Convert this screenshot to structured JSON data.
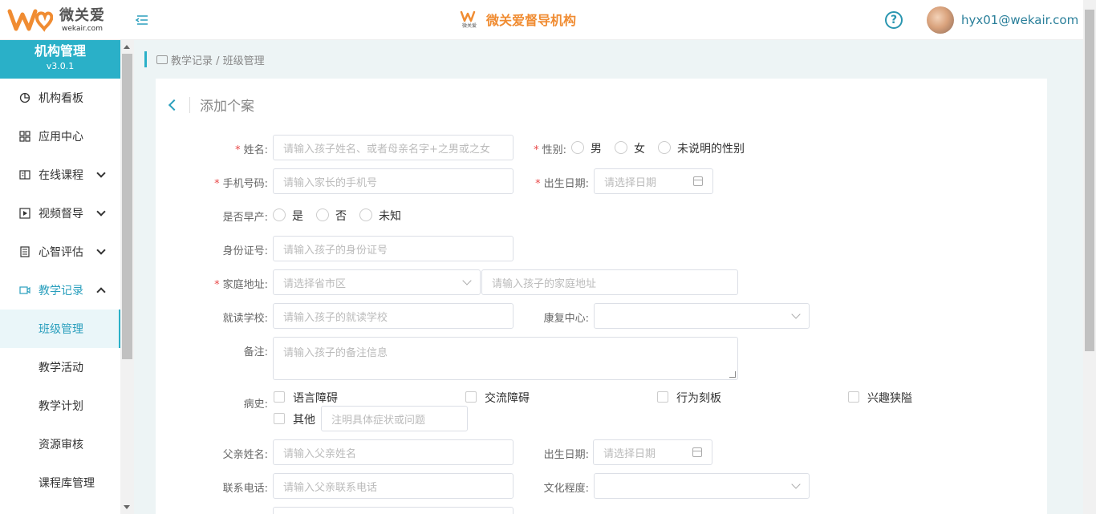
{
  "header": {
    "logo_cn": "微关爱",
    "logo_en": "wekair.com",
    "mini_logo_text": "微关爱",
    "brand_title": "微关爱督导机构",
    "help_label": "?",
    "user_email": "hyx01@wekair.com"
  },
  "sidebar": {
    "title": "机构管理",
    "version": "v3.0.1",
    "items": [
      {
        "label": "机构看板",
        "icon": "pie-chart-icon"
      },
      {
        "label": "应用中心",
        "icon": "grid-icon"
      },
      {
        "label": "在线课程",
        "icon": "book-icon"
      },
      {
        "label": "视频督导",
        "icon": "play-icon"
      },
      {
        "label": "心智评估",
        "icon": "clipboard-icon"
      },
      {
        "label": "教学记录",
        "icon": "video-icon"
      }
    ],
    "sub_items": [
      "班级管理",
      "教学活动",
      "教学计划",
      "资源审核",
      "课程库管理"
    ]
  },
  "breadcrumb": "教学记录 / 班级管理",
  "page_title": "添加个案",
  "form": {
    "name_label": "姓名:",
    "name_placeholder": "请输入孩子姓名、或者母亲名字+之男或之女",
    "gender_label": "性别:",
    "gender_options": [
      "男",
      "女",
      "未说明的性别"
    ],
    "phone_label": "手机号码:",
    "phone_placeholder": "请输入家长的手机号",
    "birth_label": "出生日期:",
    "date_placeholder": "请选择日期",
    "premature_label": "是否早产:",
    "premature_options": [
      "是",
      "否",
      "未知"
    ],
    "id_label": "身份证号:",
    "id_placeholder": "请输入孩子的身份证号",
    "address_label": "家庭地址:",
    "region_placeholder": "请选择省市区",
    "address_placeholder": "请输入孩子的家庭地址",
    "school_label": "就读学校:",
    "school_placeholder": "请输入孩子的就读学校",
    "rehab_label": "康复中心:",
    "remark_label": "备注:",
    "remark_placeholder": "请输入孩子的备注信息",
    "history_label": "病史:",
    "history_options": [
      "语言障碍",
      "交流障碍",
      "行为刻板",
      "兴趣狭隘",
      "其他"
    ],
    "other_placeholder": "注明具体症状或问题",
    "father_name_label": "父亲姓名:",
    "father_name_placeholder": "请输入父亲姓名",
    "father_birth_label": "出生日期:",
    "phone2_label": "联系电话:",
    "phone2_placeholder": "请输入父亲联系电话",
    "education_label": "文化程度:"
  },
  "colors": {
    "accent": "#2ab0c8",
    "brand_orange": "#f08c32",
    "required": "#e94848"
  }
}
